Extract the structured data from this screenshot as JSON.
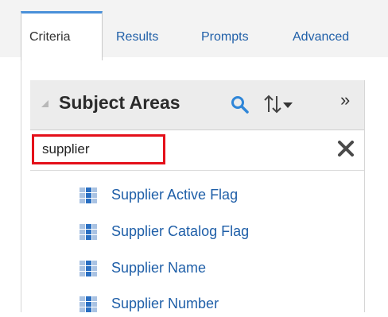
{
  "tabs": [
    {
      "label": "Criteria",
      "active": true
    },
    {
      "label": "Results",
      "active": false
    },
    {
      "label": "Prompts",
      "active": false
    },
    {
      "label": "Advanced",
      "active": false
    }
  ],
  "subject_areas": {
    "title": "Subject Areas",
    "search_value": "supplier"
  },
  "columns": [
    {
      "label": "Supplier Active Flag"
    },
    {
      "label": "Supplier Catalog Flag"
    },
    {
      "label": "Supplier Name"
    },
    {
      "label": "Supplier Number"
    }
  ],
  "colors": {
    "link": "#1f5fa8",
    "highlight_border": "#e4101a",
    "tab_accent": "#4a90d9",
    "search_icon": "#2f86d8"
  },
  "icons": {
    "collapse": "triangle-icon",
    "search": "search-icon",
    "sort": "sort-icon",
    "more": "double-chevron-right-icon",
    "clear": "close-icon",
    "column": "column-icon"
  }
}
